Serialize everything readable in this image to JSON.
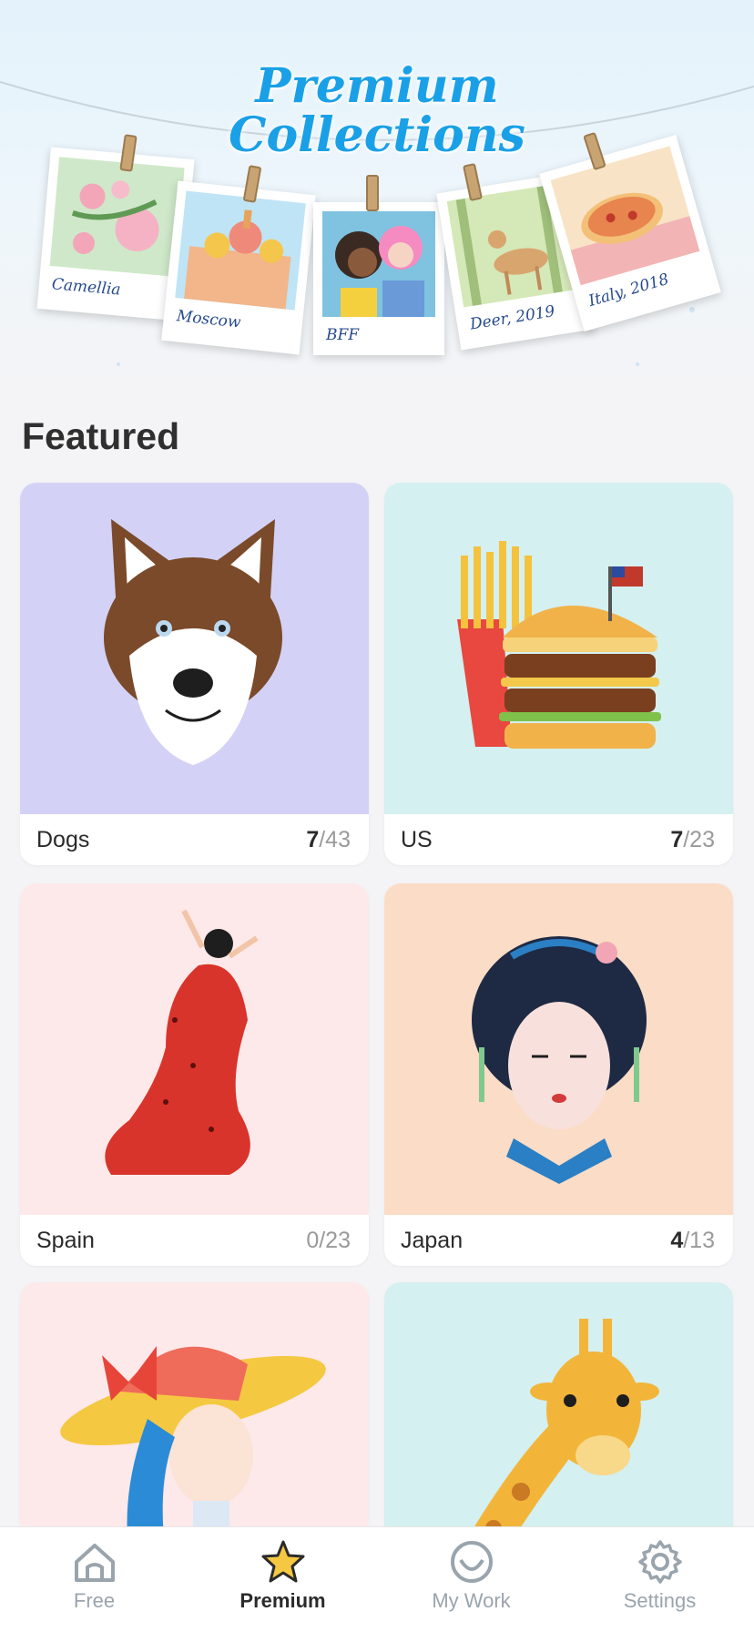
{
  "banner": {
    "title_line1": "Premium",
    "title_line2": "Collections",
    "photos": [
      {
        "caption": "Camellia"
      },
      {
        "caption": "Moscow"
      },
      {
        "caption": "BFF"
      },
      {
        "caption": "Deer, 2019"
      },
      {
        "caption": "Italy, 2018"
      }
    ]
  },
  "featured": {
    "title": "Featured",
    "cards": [
      {
        "name": "Dogs",
        "done": "7",
        "total": "/43",
        "bg": "#d3d2f6",
        "icon": "husky-icon"
      },
      {
        "name": "US",
        "done": "7",
        "total": "/23",
        "bg": "#d4f0f0",
        "icon": "burger-fries-icon"
      },
      {
        "name": "Spain",
        "done": "",
        "total": "0/23",
        "bg": "#fde9ea",
        "icon": "flamenco-dancer-icon"
      },
      {
        "name": "Japan",
        "done": "4",
        "total": "/13",
        "bg": "#fbdcc6",
        "icon": "geisha-icon"
      },
      {
        "name": "",
        "done": "",
        "total": "",
        "bg": "#fde9ea",
        "icon": "hat-lady-icon"
      },
      {
        "name": "",
        "done": "",
        "total": "",
        "bg": "#d4f0f0",
        "icon": "giraffe-icon"
      }
    ]
  },
  "tabs": [
    {
      "label": "Free",
      "icon": "home-icon",
      "active": false
    },
    {
      "label": "Premium",
      "icon": "star-icon",
      "active": true
    },
    {
      "label": "My Work",
      "icon": "smile-icon",
      "active": false
    },
    {
      "label": "Settings",
      "icon": "gear-icon",
      "active": false
    }
  ],
  "colors": {
    "accent": "#1aa0e6",
    "star": "#f5c842",
    "tab_inactive": "#9aa4ad"
  }
}
